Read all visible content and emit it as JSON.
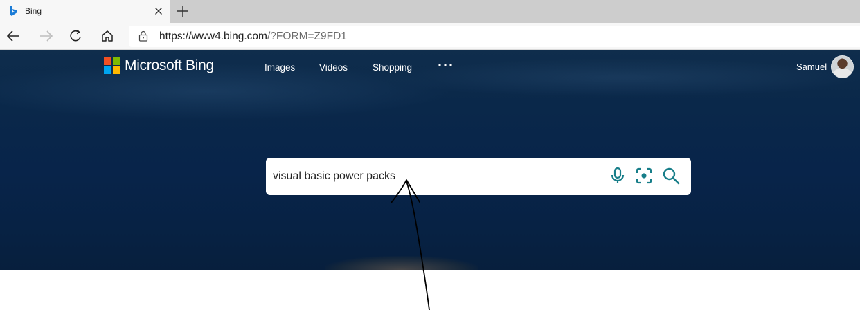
{
  "browser": {
    "tab": {
      "title": "Bing"
    },
    "address": {
      "scheme_host": "https://www4.bing.com",
      "path_query": "/?FORM=Z9FD1"
    }
  },
  "bing": {
    "brand": "Microsoft Bing",
    "nav": [
      {
        "label": "Images"
      },
      {
        "label": "Videos"
      },
      {
        "label": "Shopping"
      }
    ],
    "more_icon": "ellipsis-icon",
    "user": {
      "name": "Samuel"
    },
    "search": {
      "value": "visual basic power packs"
    },
    "logo_colors": [
      "#f25022",
      "#7fba00",
      "#00a4ef",
      "#ffb900"
    ],
    "accent": "#177e89"
  }
}
